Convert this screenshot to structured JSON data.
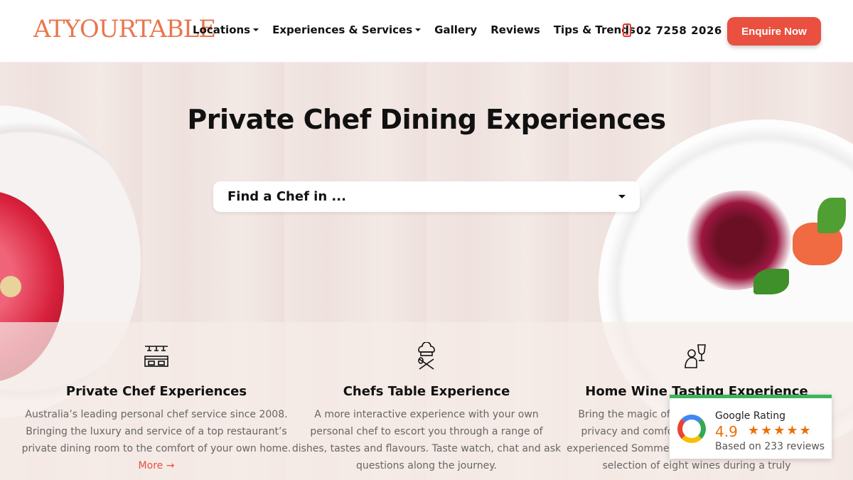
{
  "header": {
    "logo": "ATYOURTABLE",
    "nav": [
      {
        "label": "Locations",
        "dropdown": true
      },
      {
        "label": "Experiences & Services",
        "dropdown": true
      },
      {
        "label": "Gallery",
        "dropdown": false
      },
      {
        "label": "Reviews",
        "dropdown": false
      },
      {
        "label": "Tips & Trends",
        "dropdown": false
      }
    ],
    "phone": "02 7258 2026",
    "enquire_label": "Enquire Now"
  },
  "hero": {
    "title": "Private Chef Dining Experiences",
    "finder_label": "Find a Chef in ..."
  },
  "features": [
    {
      "title": "Private Chef Experiences",
      "text": "Australia’s leading personal chef service since 2008. Bringing the luxury and service of a top restaurant’s private dining room to the comfort of your own home.",
      "more": "More →",
      "icon": "chef-station-icon"
    },
    {
      "title": "Chefs Table Experience",
      "text": "A more interactive experience with your own personal chef to escort you through a range of dishes, tastes and flavours. Taste watch, chat and ask questions along the journey.",
      "more": "",
      "icon": "chef-hat-utensils-icon"
    },
    {
      "title": "Home Wine Tasting Experience",
      "text": "Bring the magic of a cellar door tasting into the privacy and comfort of your own home. Let an experienced Sommelier guide you through a tasting selection of eight wines during a truly",
      "more": "",
      "icon": "wine-taster-icon"
    }
  ],
  "rating": {
    "title": "Google Rating",
    "score": "4.9",
    "stars": "★★★★★",
    "based_on": "Based on 233 reviews"
  },
  "colors": {
    "accent": "#e9503f",
    "logo": "#e8774f",
    "rating_stars": "#e8710a",
    "rating_bar": "#3cb55a"
  }
}
